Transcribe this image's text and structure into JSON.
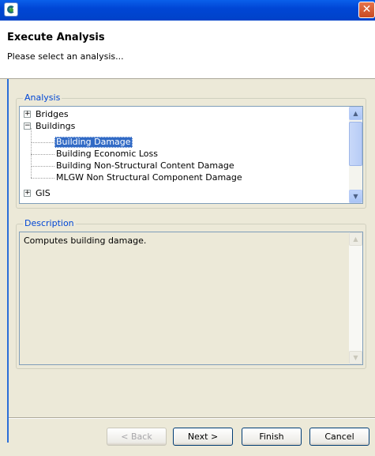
{
  "window": {
    "app_icon": "app-logo-icon",
    "close_glyph": "✕"
  },
  "header": {
    "title": "Execute Analysis",
    "subtitle": "Please select an analysis..."
  },
  "analysis_group": {
    "label": "Analysis",
    "tree": [
      {
        "label": "Bridges",
        "expander": "+"
      },
      {
        "label": "Buildings",
        "expander": "−"
      },
      {
        "label": "Building Damage",
        "selected": true
      },
      {
        "label": "Building Economic Loss"
      },
      {
        "label": "Building Non-Structural Content Damage"
      },
      {
        "label": "MLGW Non Structural Component Damage"
      },
      {
        "label": "GIS",
        "expander": "+"
      }
    ]
  },
  "description_group": {
    "label": "Description",
    "text": "Computes building damage."
  },
  "buttons": {
    "back": "< Back",
    "next": "Next >",
    "finish": "Finish",
    "cancel": "Cancel"
  },
  "colors": {
    "accent": "#0046D5",
    "selection": "#316AC5",
    "titlebar": "#0A5FEA"
  }
}
